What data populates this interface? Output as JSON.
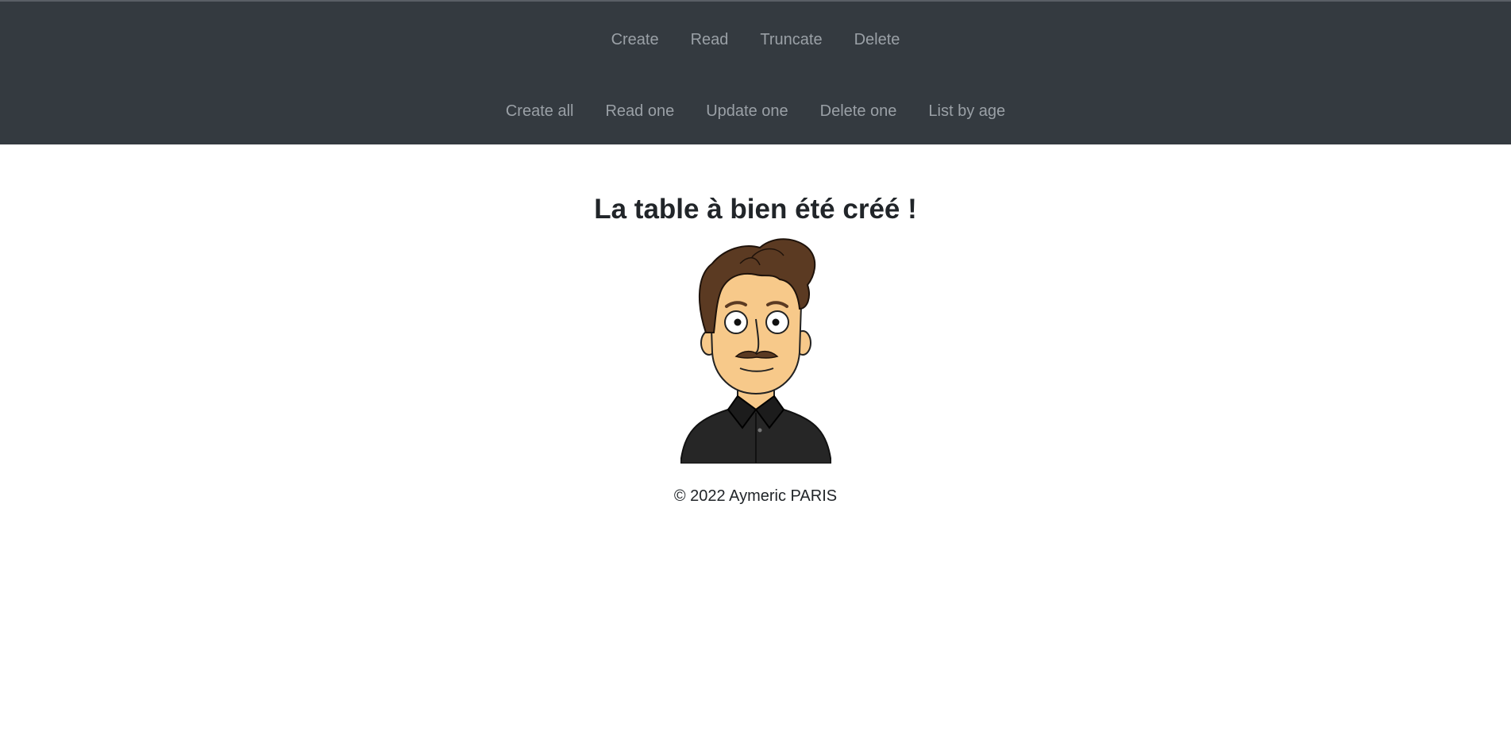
{
  "nav": {
    "row1": [
      "Create",
      "Read",
      "Truncate",
      "Delete"
    ],
    "row2": [
      "Create all",
      "Read one",
      "Update one",
      "Delete one",
      "List by age"
    ]
  },
  "main": {
    "title": "La table à bien été créé !",
    "avatar_icon": "cartoon-man-avatar"
  },
  "footer": {
    "copyright": "© 2022 Aymeric PARIS"
  },
  "colors": {
    "navbar_bg": "#343a40",
    "nav_link": "#9aa0a6",
    "text": "#212529"
  }
}
